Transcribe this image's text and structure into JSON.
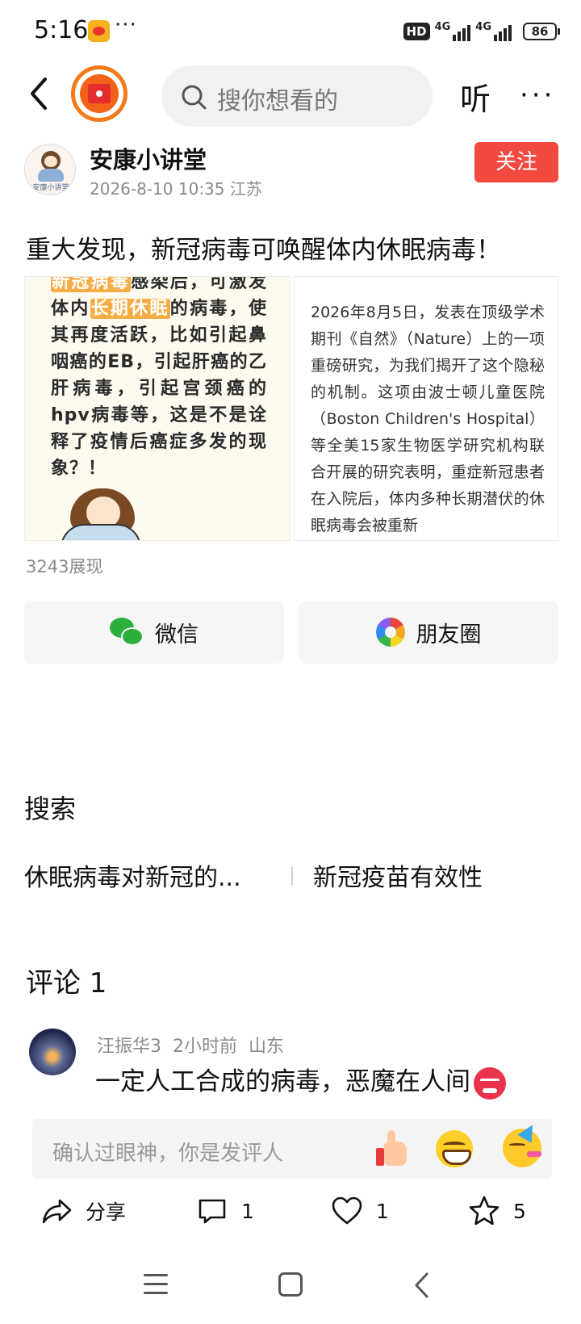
{
  "status_bar": {
    "time": "5:16",
    "dots": "···",
    "hd": "HD",
    "network_1": "4G",
    "network_2": "4G",
    "battery": "86"
  },
  "nav": {
    "search_placeholder": "搜你想看的",
    "listen_label": "听",
    "more": "···"
  },
  "author": {
    "name": "安康小讲堂",
    "avatar_text": "安康小讲堂",
    "meta": "2026-8-10 10:35  江苏",
    "follow_label": "关注"
  },
  "article": {
    "title": "重大发现，新冠病毒可唤醒体内休眠病毒！",
    "image_left": {
      "hl_1": "新冠病毒",
      "text_1": "感染后，可激发体内",
      "hl_2": "长期休眠",
      "text_2": "的病毒，使其再度活跃，比如引起鼻咽癌的EB，引起肝癌的乙肝病毒，引起宫颈癌的hpv病毒等，这是不是诠释了疫情后癌症多发的现象？！"
    },
    "image_right_text": "2026年8月5日，发表在顶级学术期刊《自然》（Nature）上的一项重磅研究，为我们揭开了这个隐秘的机制。这项由波士顿儿童医院（Boston Children's Hospital）等全美15家生物医学研究机构联合开展的研究表明，重症新冠患者在入院后，体内多种长期潜伏的休眠病毒会被重新",
    "view_count": "3243展现"
  },
  "share": {
    "wechat": "微信",
    "moments": "朋友圈"
  },
  "search_section": {
    "heading": "搜索",
    "items": [
      "休眠病毒对新冠的...",
      "新冠疫苗有效性"
    ]
  },
  "comments": {
    "heading": "评论 1",
    "list": [
      {
        "user": "汪振华3",
        "time": "2小时前",
        "location": "山东",
        "text": "一定人工合成的病毒，恶魔在人间"
      }
    ],
    "input_placeholder": "确认过眼神，你是发评人"
  },
  "action_bar": {
    "share_label": "分享",
    "comment_count": "1",
    "like_count": "1",
    "favorite_count": "5"
  },
  "colors": {
    "follow": "#f24a40",
    "highlight": "#f7ad45",
    "wechat_green": "#2bb13b"
  }
}
